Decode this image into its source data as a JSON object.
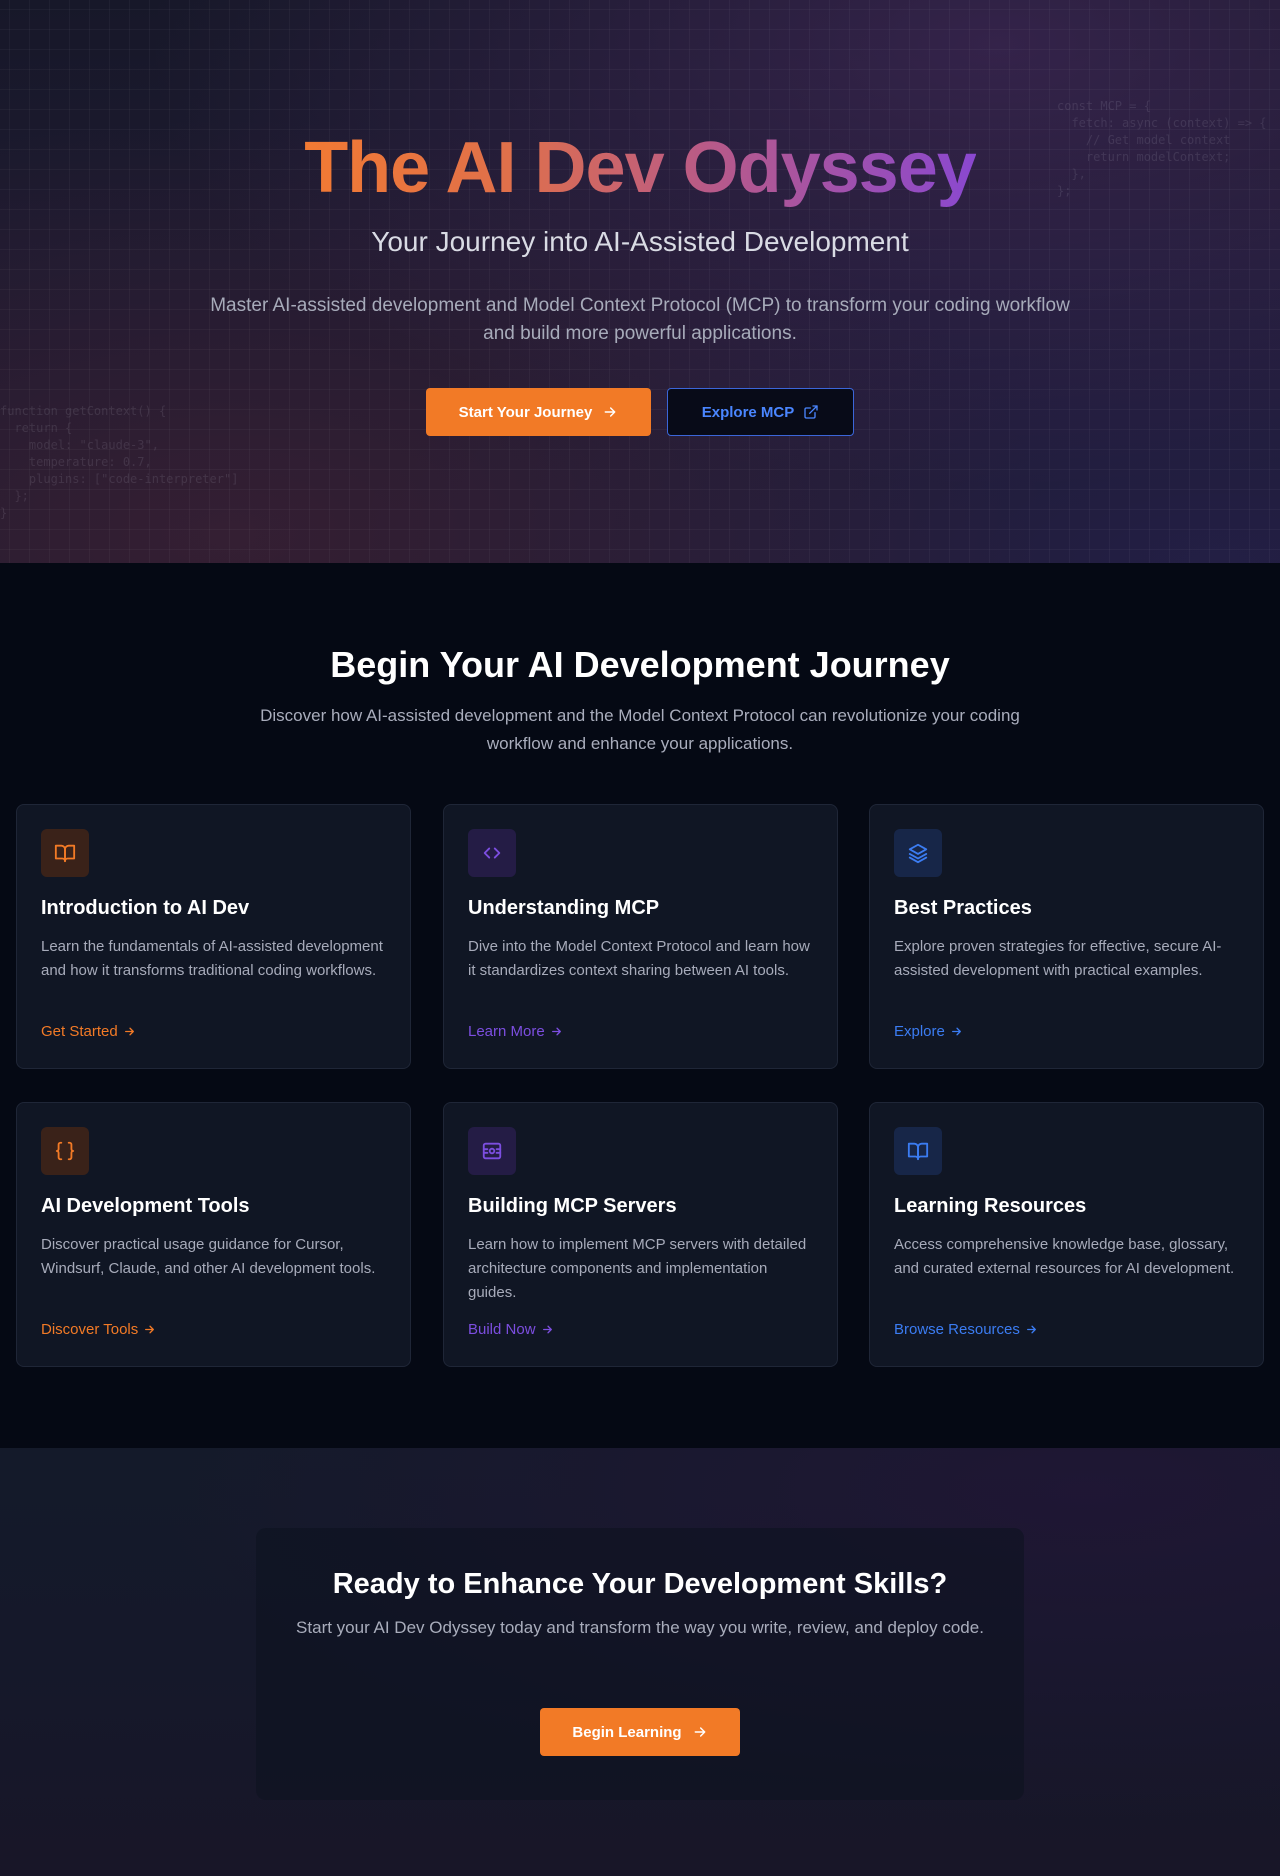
{
  "hero": {
    "title": "The AI Dev Odyssey",
    "subtitle": "Your Journey into AI-Assisted Development",
    "description": "Master AI-assisted development and Model Context Protocol (MCP) to transform your coding workflow and build more powerful applications.",
    "primary_button": "Start Your Journey",
    "secondary_button": "Explore MCP",
    "code_right": "const MCP = {\n  fetch: async (context) => {\n    // Get model context\n    return modelContext;\n  },\n};",
    "code_left": "function getContext() {\n  return {\n    model: \"claude-3\",\n    temperature: 0.7,\n    plugins: [\"code-interpreter\"]\n  };\n}"
  },
  "journey": {
    "title": "Begin Your AI Development Journey",
    "description": "Discover how AI-assisted development and the Model Context Protocol can revolutionize your coding workflow and enhance your applications.",
    "cards": [
      {
        "title": "Introduction to AI Dev",
        "description": "Learn the fundamentals of AI-assisted development and how it transforms traditional coding workflows.",
        "link": "Get Started",
        "icon": "book-open-icon",
        "accent": "#f27a26"
      },
      {
        "title": "Understanding MCP",
        "description": "Dive into the Model Context Protocol and learn how it standardizes context sharing between AI tools.",
        "link": "Learn More",
        "icon": "code-icon",
        "accent": "#7c4ee0"
      },
      {
        "title": "Best Practices",
        "description": "Explore proven strategies for effective, secure AI-assisted development with practical examples.",
        "link": "Explore",
        "icon": "layers-icon",
        "accent": "#3b7cf2"
      },
      {
        "title": "AI Development Tools",
        "description": "Discover practical usage guidance for Cursor, Windsurf, Claude, and other AI development tools.",
        "link": "Discover Tools",
        "icon": "braces-icon",
        "accent": "#f27a26"
      },
      {
        "title": "Building MCP Servers",
        "description": "Learn how to implement MCP servers with detailed architecture components and implementation guides.",
        "link": "Build Now",
        "icon": "server-icon",
        "accent": "#7c4ee0"
      },
      {
        "title": "Learning Resources",
        "description": "Access comprehensive knowledge base, glossary, and curated external resources for AI development.",
        "link": "Browse Resources",
        "icon": "book-open-icon",
        "accent": "#3b7cf2"
      }
    ]
  },
  "cta": {
    "title": "Ready to Enhance Your Development Skills?",
    "description": "Start your AI Dev Odyssey today and transform the way you write, review, and deploy code.",
    "button": "Begin Learning"
  }
}
